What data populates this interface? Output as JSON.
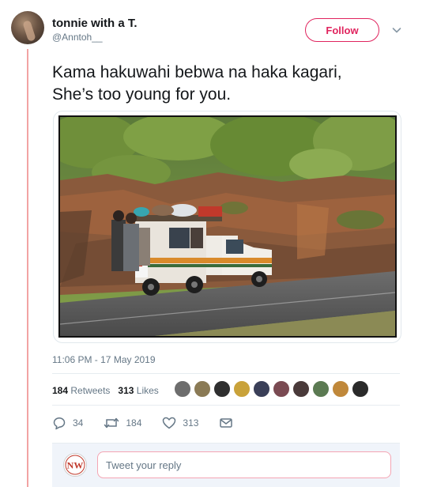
{
  "user": {
    "display_name": "tonnie with a T.",
    "handle": "@Anntoh__"
  },
  "header": {
    "follow_label": "Follow"
  },
  "tweet": {
    "text_line1": "Kama hakuwahi bebwa na haka kagari,",
    "text_line2": "She’s too young for you.",
    "timestamp": "11:06 PM - 17 May 2019"
  },
  "stats": {
    "retweets_count": "184",
    "retweets_label": "Retweets",
    "likes_count": "313",
    "likes_label": "Likes"
  },
  "actions": {
    "replies": "34",
    "retweets": "184",
    "likes": "313"
  },
  "reply": {
    "placeholder": "Tweet your reply",
    "avatar_text": "NW"
  },
  "colors": {
    "follow_accent": "#e0245e",
    "thread_line": "#f2a3a3",
    "muted_text": "#657786"
  },
  "icons": {
    "caret": "chevron-down-icon",
    "reply": "reply-icon",
    "retweet": "retweet-icon",
    "like": "heart-icon",
    "message": "envelope-icon"
  }
}
